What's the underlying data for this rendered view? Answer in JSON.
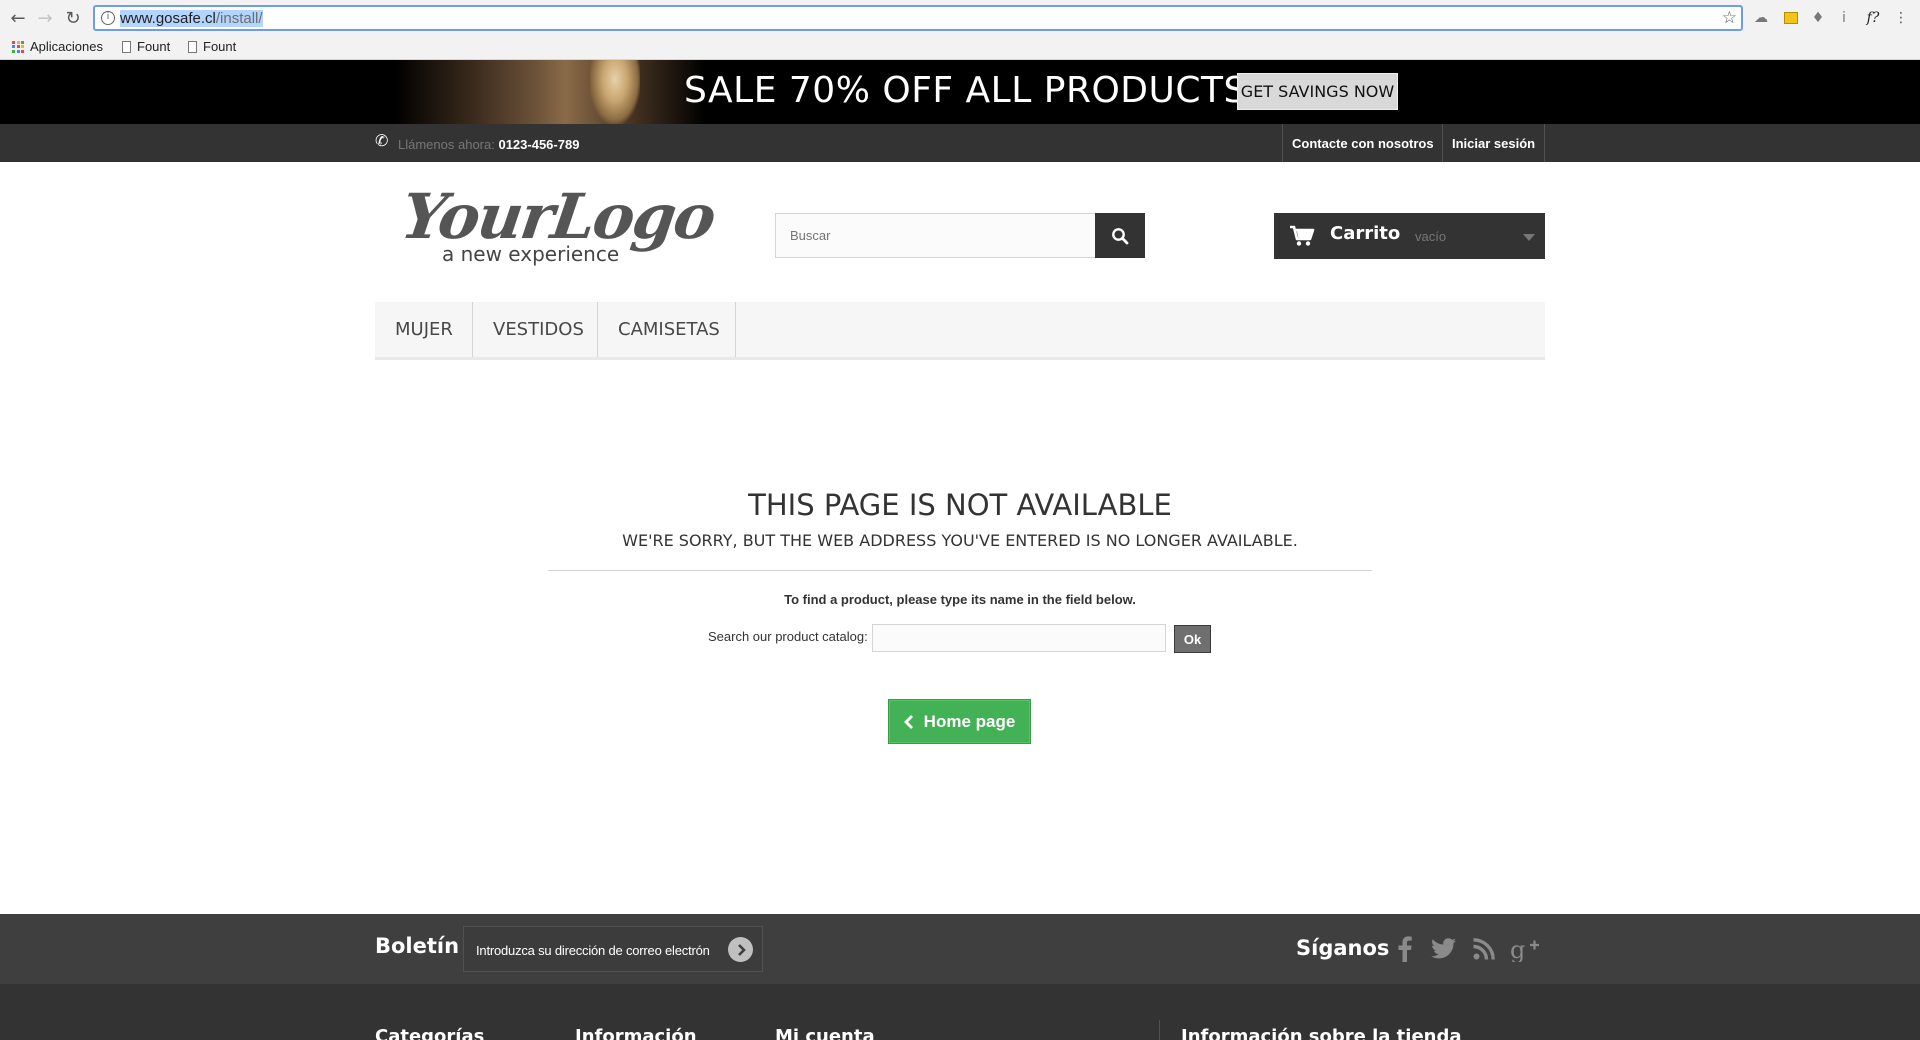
{
  "browser": {
    "url_host": "www.gosafe.cl",
    "url_path": "/install/",
    "bookmarks": [
      "Aplicaciones",
      "Fount",
      "Fount"
    ]
  },
  "banner": {
    "text": "SALE 70% OFF ALL PRODUCTS",
    "button": "GET SAVINGS NOW"
  },
  "topbar": {
    "call_label": "Llámenos ahora:",
    "phone": "0123-456-789",
    "contact": "Contacte con nosotros",
    "login": "Iniciar sesión"
  },
  "header": {
    "logo_main": "YourLogo",
    "logo_sub": "a new experience",
    "search_placeholder": "Buscar",
    "cart_title": "Carrito",
    "cart_status": "vacío"
  },
  "menu": [
    "MUJER",
    "VESTIDOS",
    "CAMISETAS"
  ],
  "content": {
    "title": "THIS PAGE IS NOT AVAILABLE",
    "subtitle": "WE'RE SORRY, BUT THE WEB ADDRESS YOU'VE ENTERED IS NO LONGER AVAILABLE.",
    "hint": "To find a product, please type its name in the field below.",
    "catalog_label": "Search our product catalog:",
    "ok": "Ok",
    "home": "Home page"
  },
  "footer": {
    "newsletter_title": "Boletín",
    "newsletter_placeholder": "Introduzca su dirección de correo electrón",
    "follow_title": "Síganos",
    "social_icons": [
      "facebook-icon",
      "twitter-icon",
      "rss-icon",
      "google-plus-icon"
    ],
    "columns": [
      "Categorías",
      "Información",
      "Mi cuenta",
      "Información sobre la tienda"
    ]
  },
  "colors": {
    "accent_green": "#43b155",
    "dark_bar": "#333333"
  }
}
